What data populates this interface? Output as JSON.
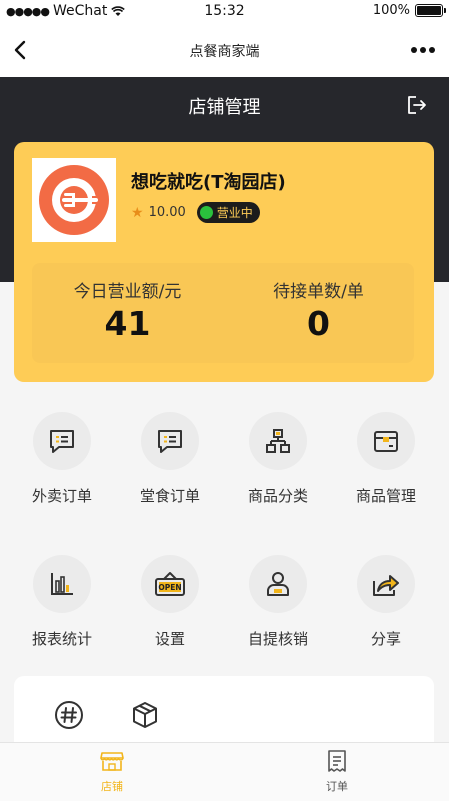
{
  "status_bar": {
    "carrier": "WeChat",
    "time": "15:32",
    "battery": "100%"
  },
  "nav": {
    "title": "点餐商家端"
  },
  "header": {
    "title": "店铺管理"
  },
  "store": {
    "name": "想吃就吃(T淘园店)",
    "rating": "10.00",
    "status": "营业中"
  },
  "stats": [
    {
      "label": "今日营业额/元",
      "value": "41"
    },
    {
      "label": "待接单数/单",
      "value": "0"
    }
  ],
  "menu": [
    {
      "label": "外卖订单",
      "icon": "takeout-order-icon"
    },
    {
      "label": "堂食订单",
      "icon": "dine-in-order-icon"
    },
    {
      "label": "商品分类",
      "icon": "category-icon"
    },
    {
      "label": "商品管理",
      "icon": "product-box-icon"
    },
    {
      "label": "报表统计",
      "icon": "bar-chart-icon"
    },
    {
      "label": "设置",
      "icon": "open-sign-icon"
    },
    {
      "label": "自提核销",
      "icon": "user-icon"
    },
    {
      "label": "分享",
      "icon": "share-icon"
    }
  ],
  "tabs": [
    {
      "label": "店铺",
      "active": true
    },
    {
      "label": "订单",
      "active": false
    }
  ],
  "colors": {
    "accent": "#fecc56",
    "dark": "#26272c",
    "icon_stroke": "#333333"
  }
}
